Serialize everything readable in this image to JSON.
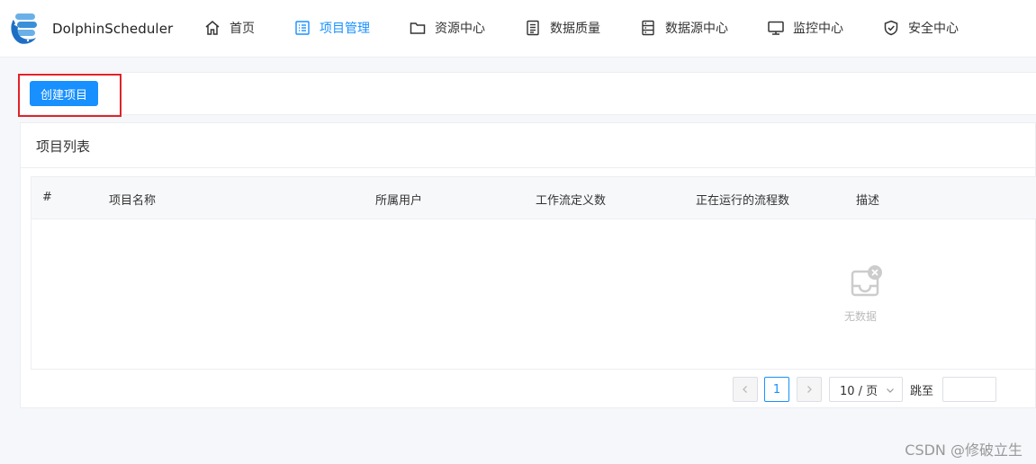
{
  "app": {
    "name": "DolphinScheduler"
  },
  "nav": {
    "items": [
      {
        "label": "首页",
        "icon": "home-icon"
      },
      {
        "label": "项目管理",
        "icon": "list-icon",
        "active": true
      },
      {
        "label": "资源中心",
        "icon": "folder-icon"
      },
      {
        "label": "数据质量",
        "icon": "document-icon"
      },
      {
        "label": "数据源中心",
        "icon": "server-icon"
      },
      {
        "label": "监控中心",
        "icon": "monitor-icon"
      },
      {
        "label": "安全中心",
        "icon": "shield-icon"
      }
    ]
  },
  "toolbar": {
    "create_label": "创建项目"
  },
  "project_list": {
    "title": "项目列表",
    "columns": [
      "#",
      "项目名称",
      "所属用户",
      "工作流定义数",
      "正在运行的流程数",
      "描述"
    ],
    "rows": [],
    "empty_text": "无数据"
  },
  "pagination": {
    "current_page": "1",
    "page_size": "10 / 页",
    "jump_label": "跳至",
    "jump_value": ""
  },
  "colors": {
    "accent": "#1890ff",
    "highlight": "#e0232a"
  },
  "watermark": "CSDN @修破立生"
}
